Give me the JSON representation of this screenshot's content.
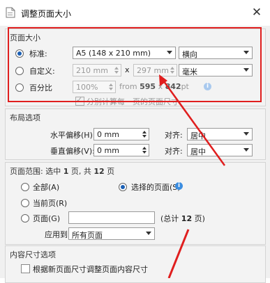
{
  "window": {
    "title": "调整页面大小",
    "close_glyph": "✕"
  },
  "page_size": {
    "title": "页面大小",
    "standard": {
      "label": "标准:",
      "size_value": "A5 (148 x 210 mm)",
      "orientation": "横向"
    },
    "custom": {
      "label": "自定义:",
      "width": "210 mm",
      "times": "x",
      "height": "297 mm",
      "unit": "毫米"
    },
    "percent": {
      "label": "百分比",
      "value": "100%",
      "from_prefix": "from",
      "from_w": "595",
      "from_x": "x",
      "from_h": "842",
      "from_unit": "pt",
      "calc_each_page": "分别计算每一页的页面尺寸"
    }
  },
  "layout": {
    "title": "布局选项",
    "h_offset_label": "水平偏移(H):",
    "h_offset_value": "0 mm",
    "v_offset_label": "垂直偏移(V):",
    "v_offset_value": "0 mm",
    "align_label": "对齐:",
    "h_align_value": "居中",
    "v_align_value": "居中"
  },
  "page_range": {
    "title_prefix": "页面范围: 选中",
    "selected_count": "1",
    "title_mid": "页, 共",
    "total_count": "12",
    "title_suffix": "页",
    "all_label": "全部(A)",
    "selected_pages_label": "选择的页面(S)",
    "current_label": "当前页(R)",
    "pages_label": "页面(G)",
    "pages_value": "",
    "total_prefix": "(总计",
    "total_value": "12",
    "total_suffix": "页)",
    "apply_label": "应用到:",
    "apply_value": "所有页面"
  },
  "content": {
    "title": "内容尺寸选项",
    "resize_content": "根据新页面尺寸调整页面内容尺寸"
  },
  "colors": {
    "accent": "#1a5fb4",
    "annotation": "#e01e1e"
  }
}
